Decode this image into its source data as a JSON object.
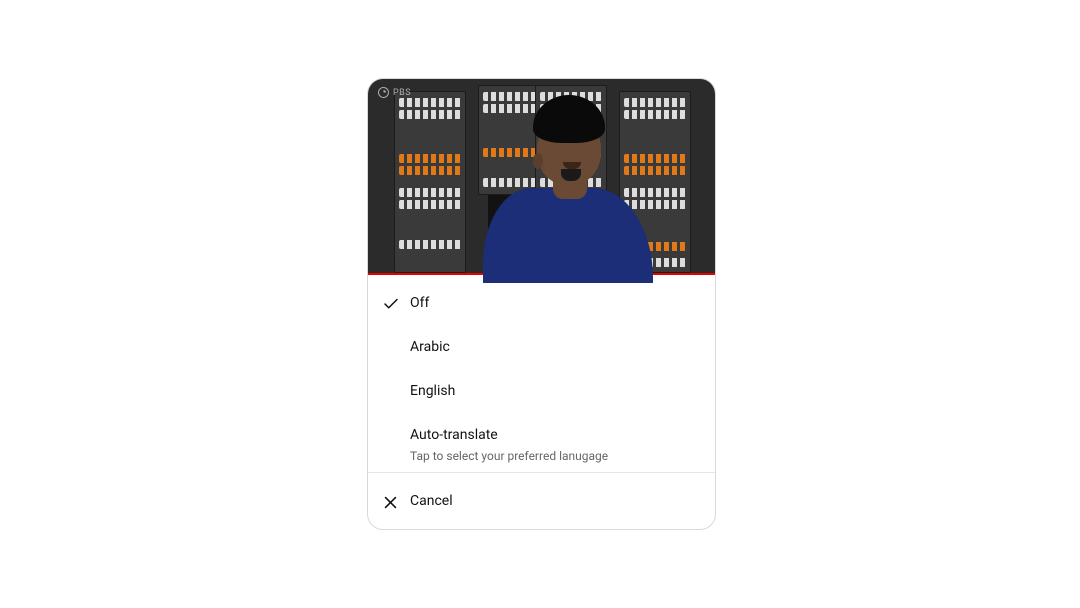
{
  "logo_text": "PBS",
  "menu": {
    "items": [
      {
        "label": "Off",
        "subtitle": "",
        "selected": true
      },
      {
        "label": "Arabic",
        "subtitle": "",
        "selected": false
      },
      {
        "label": "English",
        "subtitle": "",
        "selected": false
      },
      {
        "label": "Auto-translate",
        "subtitle": "Tap to select your preferred lanugage",
        "selected": false
      }
    ]
  },
  "cancel_label": "Cancel",
  "icons": {
    "check": "check-icon",
    "close": "close-icon"
  },
  "colors": {
    "progress": "#e60000"
  }
}
